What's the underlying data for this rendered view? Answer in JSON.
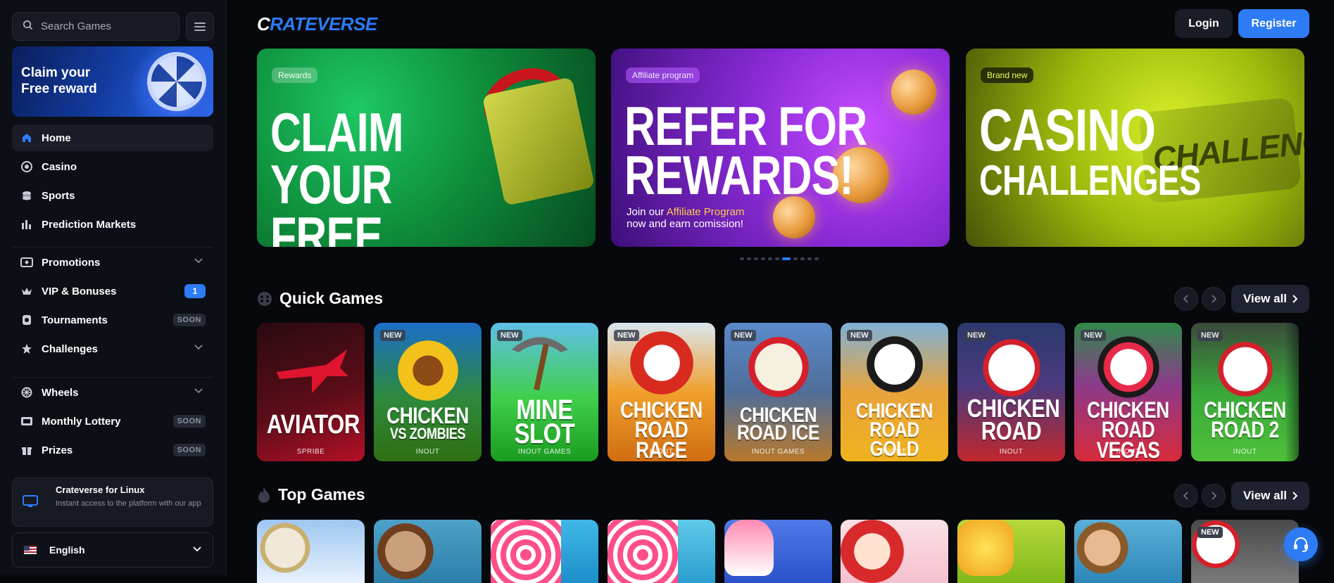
{
  "search": {
    "placeholder": "Search Games"
  },
  "sidebar": {
    "promo": "Claim your Free reward",
    "items": [
      {
        "label": "Home",
        "icon": "home-icon"
      },
      {
        "label": "Casino",
        "icon": "casino-chip-icon"
      },
      {
        "label": "Sports",
        "icon": "sports-icon"
      },
      {
        "label": "Prediction Markets",
        "icon": "chart-icon"
      },
      {
        "label": "Promotions",
        "icon": "ticket-icon"
      },
      {
        "label": "VIP & Bonuses",
        "icon": "crown-icon",
        "badge": "1"
      },
      {
        "label": "Tournaments",
        "icon": "trophy-icon",
        "badge": "SOON"
      },
      {
        "label": "Challenges",
        "icon": "star-icon"
      },
      {
        "label": "Wheels",
        "icon": "wheel-icon"
      },
      {
        "label": "Monthly Lottery",
        "icon": "lottery-icon",
        "badge": "SOON"
      },
      {
        "label": "Prizes",
        "icon": "gift-icon",
        "badge": "SOON"
      }
    ],
    "linux": {
      "title": "Crateverse for Linux",
      "desc": "Instant access to the platform with our app"
    },
    "language": "English"
  },
  "header": {
    "logo": "CRATEVERSE",
    "login": "Login",
    "register": "Register"
  },
  "banners": [
    {
      "tag": "Rewards",
      "line1": "Claim your",
      "line2": "free reward"
    },
    {
      "tag": "Affiliate program",
      "line1": "Refer for",
      "line2": "rewards!",
      "sub1": "Join our ",
      "sub_hl": "Affiliate Program",
      "sub2": "now and earn comission!"
    },
    {
      "tag": "Brand new",
      "line1": "Casino",
      "line2": "Challenges",
      "art": "CHALLENGE"
    }
  ],
  "quick_games": {
    "title": "Quick Games",
    "view_all": "View all",
    "games": [
      {
        "l1": "AVIATOR",
        "l2": "",
        "provider": "SPRIBE",
        "new": false
      },
      {
        "l1": "CHICKEN",
        "l2": "VS ZOMBIES",
        "provider": "INOUT",
        "new": true
      },
      {
        "l1": "MINE",
        "l2": "SLOT",
        "provider": "INOUT GAMES",
        "new": true
      },
      {
        "l1": "CHICKEN",
        "l2": "ROAD RACE",
        "provider": "INOUT",
        "new": true
      },
      {
        "l1": "CHICKEN",
        "l2": "ROAD ICE",
        "provider": "INOUT GAMES",
        "new": true
      },
      {
        "l1": "CHICKEN",
        "l2": "ROAD GOLD",
        "provider": "INOUT",
        "new": true
      },
      {
        "l1": "CHICKEN",
        "l2": "ROAD",
        "provider": "INOUT",
        "new": true
      },
      {
        "l1": "CHICKEN",
        "l2": "ROAD VEGAS",
        "provider": "INOUT",
        "new": true
      },
      {
        "l1": "CHICKEN",
        "l2": "ROAD 2",
        "provider": "INOUT",
        "new": true
      }
    ],
    "new_label": "NEW"
  },
  "top_games": {
    "title": "Top Games",
    "view_all": "View all",
    "new_label": "NEW"
  },
  "colors": {
    "accent": "#2d7cf6",
    "bg": "#07080c",
    "sidebar": "#0d0f16"
  }
}
